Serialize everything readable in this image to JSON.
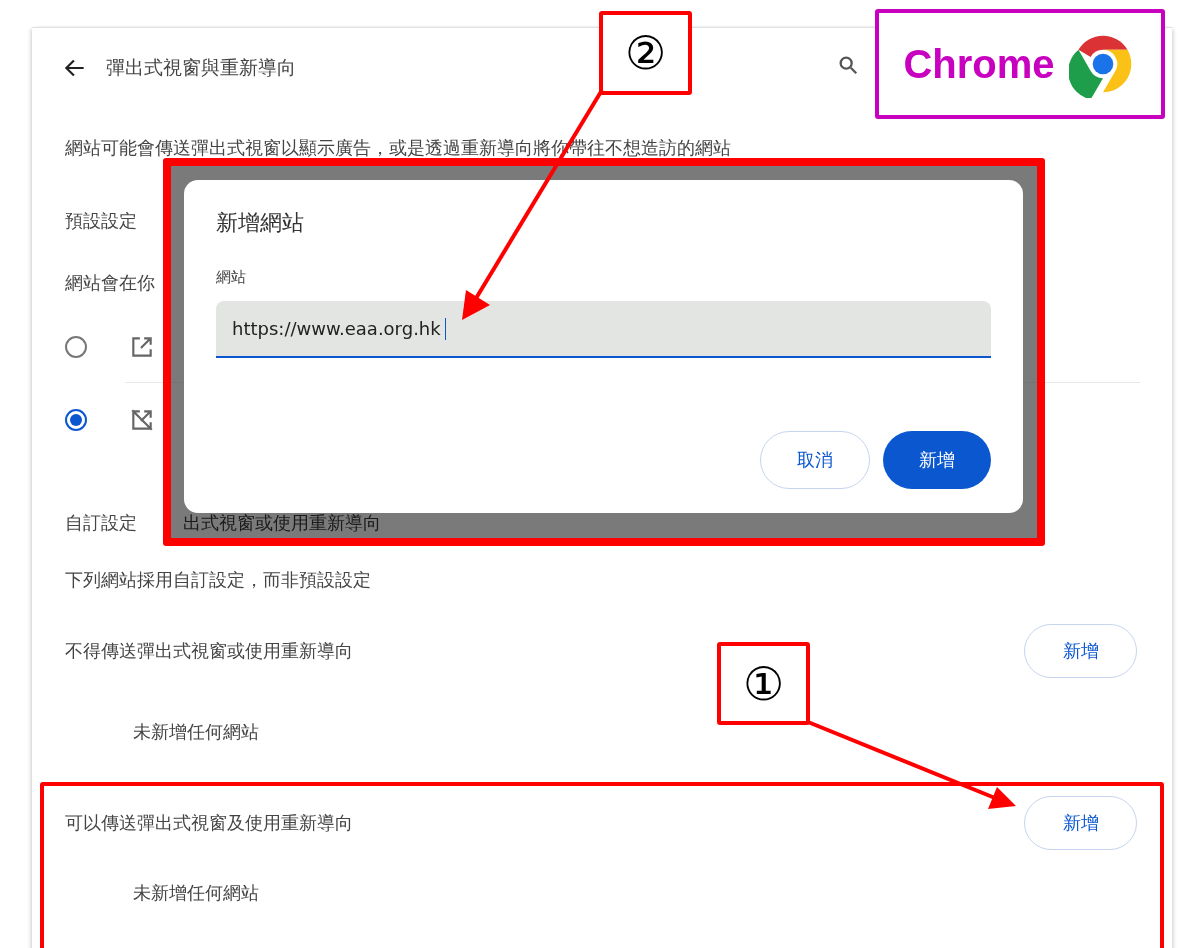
{
  "header": {
    "title": "彈出式視窗與重新導向"
  },
  "description": "網站可能會傳送彈出式視窗以顯示廣告，或是透過重新導向將你帶往不想造訪的網站",
  "default_section": {
    "heading": "預設設定",
    "subtext": "網站會在你"
  },
  "default_options": [
    {
      "kind": "allow",
      "selected": false
    },
    {
      "kind": "block",
      "selected": true
    }
  ],
  "custom_section": {
    "heading": "自訂設定",
    "dimmed_text": "出式視窗或使用重新導向",
    "subtext": "下列網站採用自訂設定，而非預設設定"
  },
  "site_lists": [
    {
      "title": "不得傳送彈出式視窗或使用重新導向",
      "button": "新增",
      "empty_text": "未新增任何網站"
    },
    {
      "title": "可以傳送彈出式視窗及使用重新導向",
      "button": "新增",
      "empty_text": "未新增任何網站"
    }
  ],
  "dialog": {
    "title": "新增網站",
    "field_label": "網站",
    "field_value": "https://www.eaa.org.hk",
    "buttons": [
      {
        "label": "取消",
        "kind": "secondary"
      },
      {
        "label": "新增",
        "kind": "primary"
      }
    ]
  },
  "annotations": {
    "step_1": "①",
    "step_2": "②",
    "browser_label": "Chrome"
  }
}
